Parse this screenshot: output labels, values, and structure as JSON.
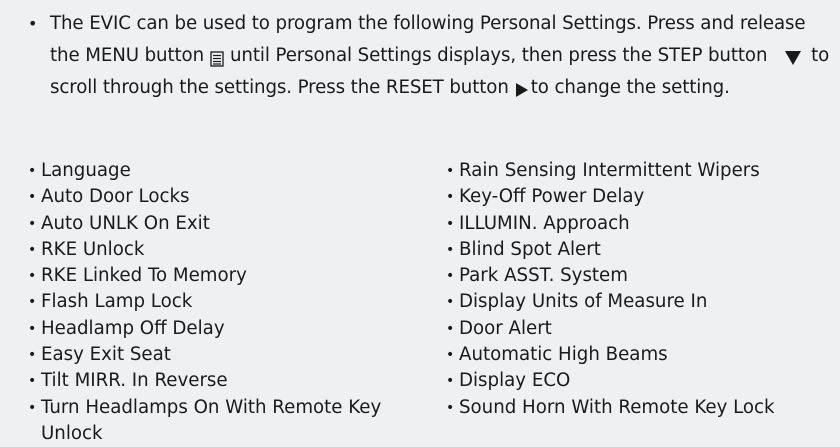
{
  "intro": {
    "bullet": "•",
    "part1": "The EVIC can be used to program the following Personal Settings. Press and release the MENU button",
    "part2": "until Personal Settings displays, then press the STEP button",
    "part3": "to scroll through the settings. Press the RESET button",
    "part4": "to change the setting.",
    "icons": [
      "menu-icon",
      "step-down-triangle-icon",
      "reset-right-triangle-icon"
    ]
  },
  "settings_left": [
    "Language",
    "Auto Door Locks",
    "Auto UNLK On Exit",
    "RKE Unlock",
    "RKE Linked To Memory",
    "Flash Lamp Lock",
    "Headlamp Off Delay",
    "Easy Exit Seat",
    "Tilt MIRR. In Reverse",
    "Turn Headlamps On With Remote Key"
  ],
  "settings_left_last_wrap": "Unlock",
  "settings_right": [
    "Rain Sensing Intermittent Wipers",
    "Key-Off Power Delay",
    "ILLUMIN. Approach",
    "Blind Spot Alert",
    "Park ASST. System",
    "Display Units of Measure In",
    "Door Alert",
    "Automatic High Beams",
    "Display ECO",
    "Sound Horn With Remote Key Lock"
  ],
  "colors": {
    "background": "#eef0f2",
    "text": "#1a1a1a"
  }
}
